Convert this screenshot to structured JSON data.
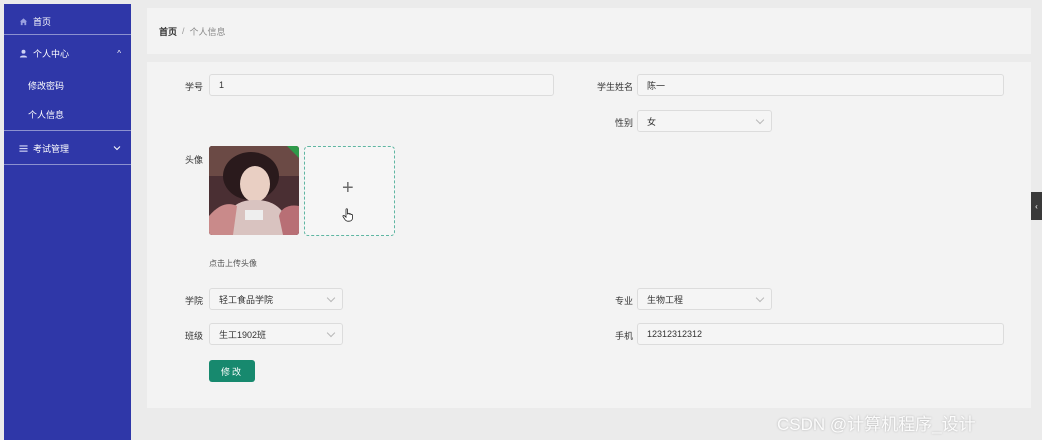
{
  "sidebar": {
    "home_label": "首页",
    "personal_center_label": "个人中心",
    "change_password_label": "修改密码",
    "personal_info_label": "个人信息",
    "exam_management_label": "考试管理"
  },
  "breadcrumb": {
    "home": "首页",
    "separator": "/",
    "current": "个人信息"
  },
  "form": {
    "student_id_label": "学号",
    "student_id_value": "1",
    "student_name_label": "学生姓名",
    "student_name_value": "陈一",
    "gender_label": "性别",
    "gender_value": "女",
    "avatar_label": "头像",
    "upload_hint": "点击上传头像",
    "college_label": "学院",
    "college_value": "轻工食品学院",
    "major_label": "专业",
    "major_value": "生物工程",
    "class_label": "班级",
    "class_value": "生工1902班",
    "phone_label": "手机",
    "phone_value": "12312312312",
    "submit_label": "修改"
  },
  "watermark": "CSDN @计算机程序_设计",
  "colors": {
    "sidebar_bg": "#2f37a8",
    "primary_button": "#17896e",
    "upload_border": "#5fb6a2"
  }
}
